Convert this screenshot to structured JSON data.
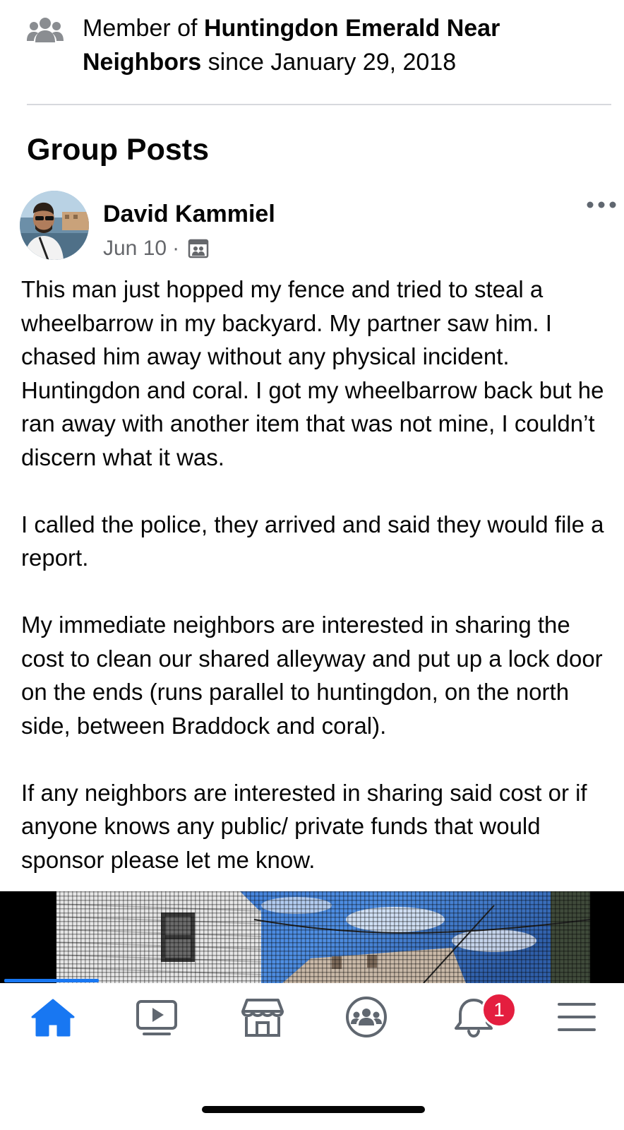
{
  "membership": {
    "prefix": "Member of ",
    "group_name": "Huntingdon Emerald Near Neighbors",
    "suffix": " since January 29, 2018",
    "icon": "group-icon"
  },
  "section": {
    "title": "Group Posts"
  },
  "post": {
    "author": "David Kammiel",
    "date": "Jun 10",
    "separator": "·",
    "audience_icon": "group-audience-icon",
    "more_icon": "more-options-icon",
    "paragraphs": [
      "This man just hopped my fence and tried to steal a wheelbarrow in my backyard. My partner saw him. I chased him away without any physical incident. Huntingdon and coral. I got my wheelbarrow back but he ran away with another item that was not mine, I couldn’t discern what it was.",
      "I called the police, they arrived and said they would file a report.",
      "My immediate neighbors are interested in sharing the cost to clean our shared alleyway and put up a lock door on the ends (runs parallel to huntingdon, on the north side, between Braddock and coral).",
      "If any neighbors are interested in sharing said cost or if anyone knows any public/ private funds that would sponsor please let me know."
    ]
  },
  "tab_bar": {
    "tabs": [
      {
        "name": "home",
        "icon": "home-icon",
        "active": true
      },
      {
        "name": "watch",
        "icon": "video-icon",
        "active": false
      },
      {
        "name": "marketplace",
        "icon": "marketplace-icon",
        "active": false
      },
      {
        "name": "groups",
        "icon": "groups-icon",
        "active": false
      },
      {
        "name": "notifications",
        "icon": "bell-icon",
        "active": false
      },
      {
        "name": "menu",
        "icon": "hamburger-menu-icon",
        "active": false
      }
    ],
    "notifications_badge": "1"
  },
  "colors": {
    "accent": "#1877f2",
    "badge": "#e41e3f",
    "secondary_text": "#65676b",
    "icon_gray": "#606770"
  }
}
